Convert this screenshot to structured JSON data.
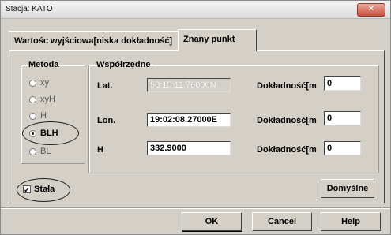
{
  "window": {
    "title": "Stacja: KATO",
    "close_symbol": "✕"
  },
  "tabs": [
    {
      "label": "Wartośc wyjściowa[niska dokładność]"
    },
    {
      "label": "Znany punkt"
    }
  ],
  "metoda": {
    "legend": "Metoda",
    "options": [
      {
        "label": "xy",
        "selected": false
      },
      {
        "label": "xyH",
        "selected": false
      },
      {
        "label": "H",
        "selected": false
      },
      {
        "label": "BLH",
        "selected": true
      },
      {
        "label": "BL",
        "selected": false
      }
    ]
  },
  "wspolrzedne": {
    "legend": "Współrzędne",
    "rows": [
      {
        "label": "Lat.",
        "value": "50:15:11.76000N",
        "accuracy_label": "Dokładność[m",
        "accuracy_value": "0"
      },
      {
        "label": "Lon.",
        "value": "19:02:08.27000E",
        "accuracy_label": "Dokładność[m",
        "accuracy_value": "0"
      },
      {
        "label": "H",
        "value": "332.9000",
        "accuracy_label": "Dokładność[m",
        "accuracy_value": "0"
      }
    ]
  },
  "stala": {
    "label": "Stała",
    "checked": true,
    "check_mark": "✔"
  },
  "buttons": {
    "domyslne": "Domyślne",
    "ok": "OK",
    "cancel": "Cancel",
    "help": "Help"
  }
}
